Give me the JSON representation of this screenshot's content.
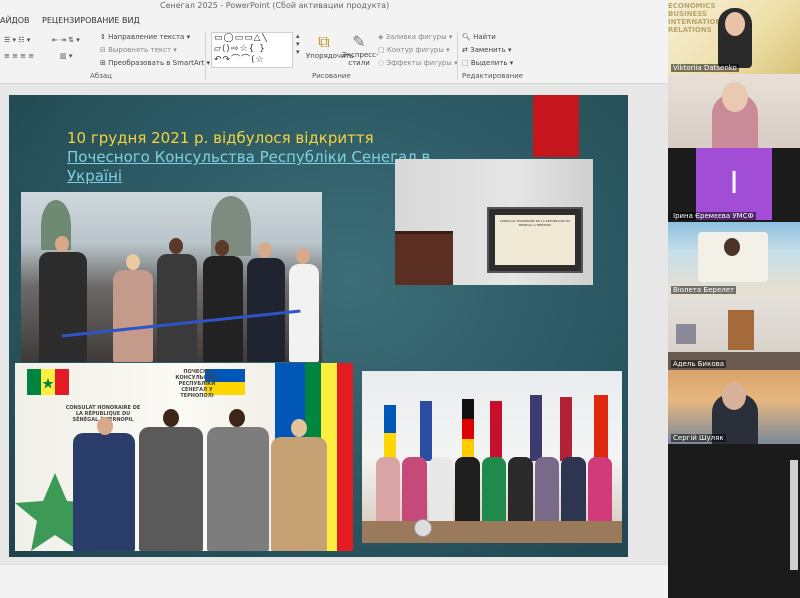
{
  "window": {
    "title": "Сенегал 2025 - PowerPoint (Сбой активации продукта)"
  },
  "tabs": [
    {
      "label": "АЙДОВ"
    },
    {
      "label": "РЕЦЕНЗИРОВАНИЕ"
    },
    {
      "label": "ВИД"
    }
  ],
  "ribbon": {
    "paragraph": {
      "text_direction": "Направление текста",
      "align_text": "Выровнять текст",
      "smartart": "Преобразовать в SmartArt",
      "label": "Абзац"
    },
    "drawing": {
      "arrange": "Упорядочить",
      "quick_styles": "Экспресс-стили",
      "shape_fill": "Заливка фигуры",
      "shape_outline": "Контур фигуры",
      "shape_effects": "Эффекты фигуры",
      "label": "Рисование"
    },
    "editing": {
      "find": "Найти",
      "replace": "Заменить",
      "select": "Выделить",
      "label": "Редактирование"
    }
  },
  "slide": {
    "title_date": "10 грудня 2021 р. відбулося відкриття ",
    "title_link": "Почесного Консульства Республіки Сенегал в Україні",
    "plaque_text": "CONSULAT HONORAIRE DE LA REPUBLIQUE DU SENEGAL A TERNOPIL",
    "banner_fr": "CONSULAT HONORAIRE DE LA RÉPUBLIQUE DU SÉNÉGAL À TERNOPIL",
    "banner_ua": "ПОЧЕСНЕ КОНСУЛЬСТВО РЕСПУБЛІКИ СЕНЕГАЛ У ТЕРНОПОЛІ"
  },
  "participants": [
    {
      "name": "Viktoriia Datsenko"
    },
    {
      "name": ""
    },
    {
      "name": "Ірина Єремєєва УМСФ",
      "initial": "І"
    },
    {
      "name": "Віолета Берелет"
    },
    {
      "name": "Адель Бикова"
    },
    {
      "name": "Сергій Шуляк"
    }
  ],
  "colors": {
    "slide_bg": "#2b5862",
    "title_yellow": "#f5d33c",
    "title_link": "#7fd0e0",
    "red_accent": "#c4161c",
    "avatar_purple": "#a24dd6"
  }
}
